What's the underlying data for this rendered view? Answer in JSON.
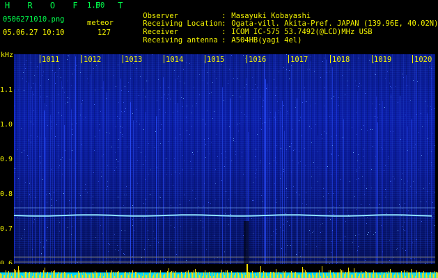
{
  "header": {
    "app_name": "H R O F F T",
    "version": "1.00",
    "filename": "0506271010.png",
    "detector_label": "meteor",
    "datetime": "05.06.27 10:10",
    "meteor_count": "127",
    "fields": [
      {
        "label": "Observer",
        "value": "Masayuki Kobayashi"
      },
      {
        "label": "Receiving Location",
        "value": "Ogata-vill. Akita-Pref. JAPAN (139.96E, 40.02N)"
      },
      {
        "label": "Receiver",
        "value": "ICOM IC-575 53.7492(@LCD)MHz USB"
      },
      {
        "label": "Receiving antenna",
        "value": "A504HB(yagi 4el)"
      }
    ]
  },
  "axis": {
    "unit": "kHz",
    "y_ticks": [
      "1.1",
      "1.0",
      "0.9",
      "0.8",
      "0.7",
      "0.6"
    ],
    "x_ticks": [
      "1011",
      "1012",
      "1013",
      "1014",
      "1015",
      "1016",
      "1017",
      "1018",
      "1019",
      "1020"
    ]
  },
  "colors": {
    "label_yellow": "#f2f200",
    "brand_green": "#00ff4c",
    "background": "#000000",
    "spectrum_blue": "#0b1ca4",
    "carrier_line": "#8fe3ff",
    "histogram_cyan": "#00d8ff",
    "histogram_yellow": "#ffe000"
  }
}
